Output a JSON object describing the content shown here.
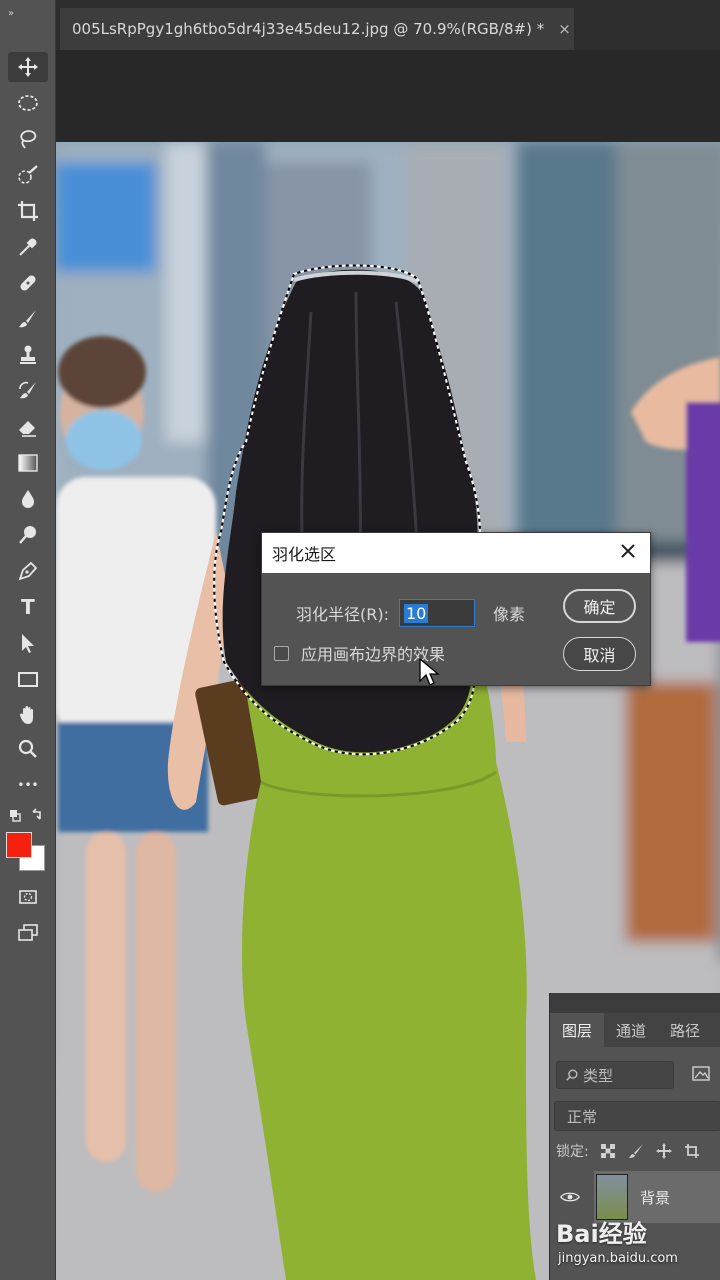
{
  "document_tab": {
    "title": "005LsRpPgy1gh6tbo5dr4j33e45deu12.jpg @ 70.9%(RGB/8#) *",
    "close": "×"
  },
  "toolbar": {
    "collapse": "»",
    "tools": [
      "move-tool",
      "marquee-tool",
      "lasso-tool",
      "quick-select-tool",
      "crop-tool",
      "eyedropper-tool",
      "healing-tool",
      "brush-tool",
      "stamp-tool",
      "history-brush-tool",
      "eraser-tool",
      "gradient-tool",
      "blur-tool",
      "dodge-tool",
      "pen-tool",
      "type-tool",
      "path-select-tool",
      "rectangle-tool",
      "hand-tool",
      "zoom-tool",
      "more-tools"
    ],
    "type_glyph": "T",
    "more_glyph": "•••",
    "foreground_color": "#f5210f",
    "background_color": "#ffffff"
  },
  "feather_dialog": {
    "title": "羽化选区",
    "radius_label": "羽化半径(R):",
    "radius_value": "10",
    "unit": "像素",
    "checkbox_label": "应用画布边界的效果",
    "ok_label": "确定",
    "cancel_label": "取消"
  },
  "layers_panel": {
    "tabs": [
      "图层",
      "通道",
      "路径"
    ],
    "filter_label": "类型",
    "blend_mode": "正常",
    "lock_label": "锁定:",
    "layer_name": "背景"
  },
  "watermark": {
    "logo": "Bai经验",
    "url": "jingyan.baidu.com"
  }
}
